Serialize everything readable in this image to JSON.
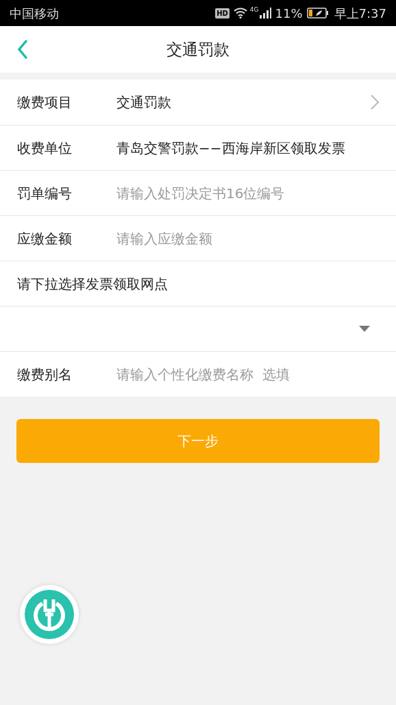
{
  "status_bar": {
    "carrier": "中国移动",
    "hd": "HD",
    "network": "4G",
    "battery": "11%",
    "time": "早上7:37"
  },
  "header": {
    "title": "交通罚款"
  },
  "form_rows": [
    {
      "kind": "select",
      "label": "缴费项目",
      "value": "交通罚款"
    },
    {
      "kind": "text",
      "label": "收费单位",
      "value": "青岛交警罚款−−西海岸新区领取发票"
    },
    {
      "kind": "input",
      "label": "罚单编号",
      "placeholder": "请输入处罚决定书16位编号"
    },
    {
      "kind": "input",
      "label": "应缴金额",
      "placeholder": "请输入应缴金额"
    },
    {
      "kind": "heading",
      "label": "请下拉选择发票领取网点"
    },
    {
      "kind": "dropdown"
    },
    {
      "kind": "input",
      "label": "缴费别名",
      "placeholder": "请输入个性化缴费名称  选填"
    }
  ],
  "next_button": "下一步"
}
